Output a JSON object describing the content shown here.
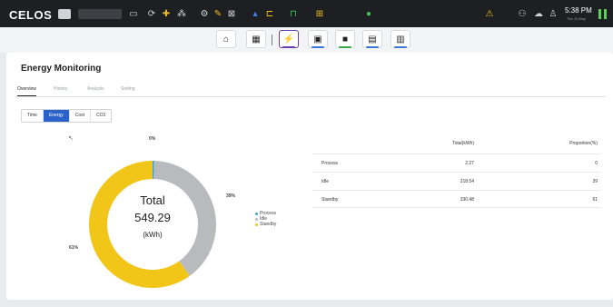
{
  "topbar": {
    "logo": "CELOS",
    "time": "5:38 PM",
    "date": "Thu 11 May"
  },
  "app_toolbar": {
    "buttons": [
      {
        "name": "home-button",
        "icon": "home-icon",
        "glyph": "⌂",
        "underline": ""
      },
      {
        "name": "apps-grid-button",
        "icon": "grid-icon",
        "glyph": "▦",
        "underline": ""
      },
      {
        "name": "energy-button",
        "icon": "energy-icon",
        "glyph": "⚡",
        "underline": "#6b3ea8"
      },
      {
        "name": "app-button-4",
        "icon": "machine-icon",
        "glyph": "▣",
        "underline": "#3a78d4"
      },
      {
        "name": "app-button-5",
        "icon": "folder-icon",
        "glyph": "■",
        "underline": "#39a845"
      },
      {
        "name": "app-button-6",
        "icon": "document-icon",
        "glyph": "▤",
        "underline": "#3a78d4"
      },
      {
        "name": "app-button-7",
        "icon": "chat-icon",
        "glyph": "▥",
        "underline": "#3a78d4"
      }
    ]
  },
  "page": {
    "title": "Energy Monitoring",
    "tabs": [
      "Overview",
      "History",
      "Analysis",
      "Setting"
    ],
    "active_tab": "Overview",
    "segments": [
      "Time",
      "Energy",
      "Cost",
      "CO2"
    ],
    "active_segment": "Energy"
  },
  "donut": {
    "center_title": "Total",
    "center_value": "549.29",
    "center_unit": "(kWh)",
    "labels": {
      "process": "0%",
      "idle": "39%",
      "standby": "61%"
    }
  },
  "legend": [
    "Process",
    "Idle",
    "Standby"
  ],
  "colors": {
    "process": "#3aa6c9",
    "idle": "#b9babe",
    "standby": "#f2c619",
    "accent": "#2a62c9"
  },
  "table": {
    "headers": [
      "",
      "Total(kWh)",
      "Proportion(%)"
    ],
    "rows": [
      [
        "Process",
        "2.27",
        "0"
      ],
      [
        "Idle",
        "218.54",
        "39"
      ],
      [
        "Standby",
        "330.48",
        "61"
      ]
    ]
  },
  "chart_data": {
    "type": "pie",
    "categories": [
      "Process",
      "Idle",
      "Standby"
    ],
    "values": [
      2.27,
      218.54,
      330.48
    ],
    "title": "Total 549.29 (kWh)"
  }
}
